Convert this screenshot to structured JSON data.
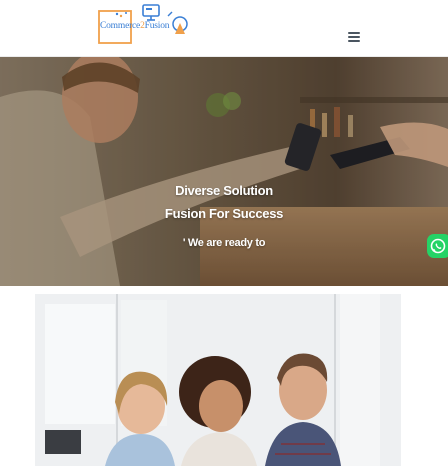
{
  "header": {
    "logo_alt": "Commerce2Fusion logo",
    "logo_text": {
      "part1": "Commerce",
      "part2": "2",
      "part3": "Fusion"
    },
    "menu_icon": "hamburger-menu-icon"
  },
  "hero": {
    "line1": "Diverse Solution",
    "line2": "Fusion For Success",
    "line3": "' We are ready to"
  },
  "floating": {
    "whatsapp_icon": "whatsapp-icon"
  },
  "colors": {
    "logo_blue": "#3a7fd5",
    "logo_orange": "#f0a04b",
    "whatsapp_green": "#25d366"
  }
}
